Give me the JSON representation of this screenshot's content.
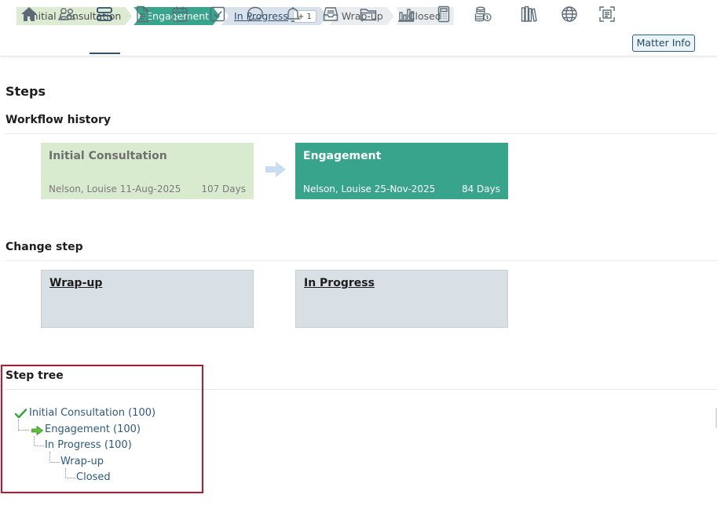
{
  "breadcrumb": [
    {
      "label": "Initial Consultation",
      "state": "done"
    },
    {
      "label": "Engagement",
      "state": "active"
    },
    {
      "label": "In Progress",
      "state": "current",
      "badge": "+ 1"
    },
    {
      "label": "Wrap-up",
      "state": "future"
    },
    {
      "label": "Closed",
      "state": "future"
    }
  ],
  "toolbar": {
    "icons": [
      "home-icon",
      "people-icon",
      "steps-icon",
      "document-icon",
      "calendar-icon",
      "checkbox-icon",
      "chat-icon",
      "bell-icon",
      "inbox-icon",
      "folder-icon",
      "bar-chart-icon",
      "calculator-icon",
      "coins-icon",
      "library-icon",
      "globe-icon",
      "scan-icon"
    ],
    "matter_info_label": "Matter Info"
  },
  "page": {
    "title": "Steps"
  },
  "workflow_history": {
    "heading": "Workflow history",
    "cards": [
      {
        "title": "Initial Consultation",
        "who": "Nelson, Louise 11-Aug-2025",
        "days": "107 Days"
      },
      {
        "title": "Engagement",
        "who": "Nelson, Louise 25-Nov-2025",
        "days": "84 Days"
      }
    ]
  },
  "change_step": {
    "heading": "Change step",
    "options": [
      {
        "label": "Wrap-up"
      },
      {
        "label": "In Progress"
      }
    ]
  },
  "step_tree": {
    "heading": "Step tree",
    "items": [
      {
        "label": "Initial Consultation (100)",
        "level": 0,
        "icon": "check-icon"
      },
      {
        "label": "Engagement (100)",
        "level": 1,
        "icon": "arrow-right-icon"
      },
      {
        "label": "In Progress (100)",
        "level": 2
      },
      {
        "label": "Wrap-up",
        "level": 3
      },
      {
        "label": "Closed",
        "level": 4
      }
    ]
  },
  "colors": {
    "done": "#dcebd1",
    "active": "#37a48b",
    "current": "#d9e2ea",
    "accent": "#2d4f73",
    "highlight": "#c0162c"
  }
}
